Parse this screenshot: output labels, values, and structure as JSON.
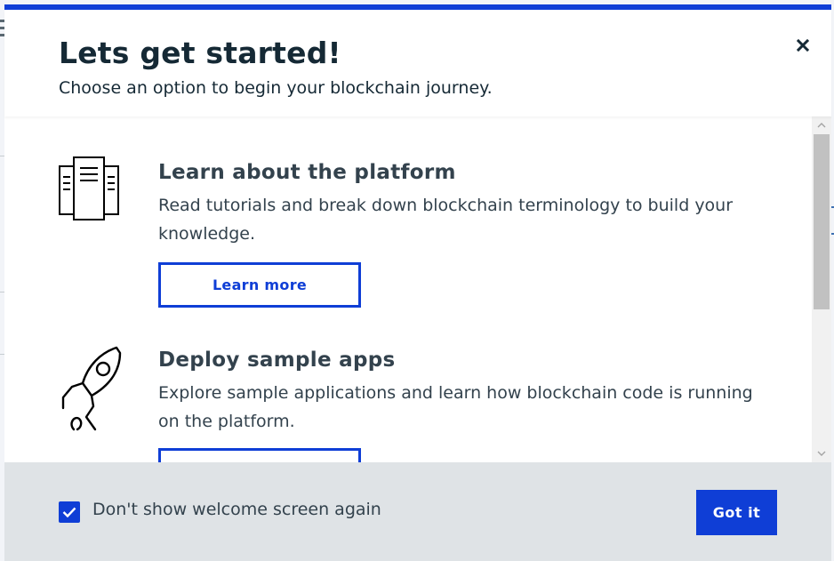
{
  "modal": {
    "title": "Lets get started!",
    "subtitle": "Choose an option to begin your blockchain journey.",
    "close_icon": "close-icon",
    "accent_color": "#0f3ed6"
  },
  "options": [
    {
      "icon": "documents-icon",
      "title": "Learn about the platform",
      "description": "Read tutorials and break down blockchain terminology to build your knowledge.",
      "button_label": "Learn more"
    },
    {
      "icon": "rocket-icon",
      "title": "Deploy sample apps",
      "description": "Explore sample applications and learn how blockchain code is running on the platform.",
      "button_label": ""
    }
  ],
  "footer": {
    "checkbox_checked": true,
    "checkbox_label": "Don't show welcome screen again",
    "primary_button": "Got it",
    "background_color": "#dfe3e6"
  },
  "scrollbar": {
    "up_icon": "chevron-up-icon",
    "down_icon": "chevron-down-icon"
  }
}
